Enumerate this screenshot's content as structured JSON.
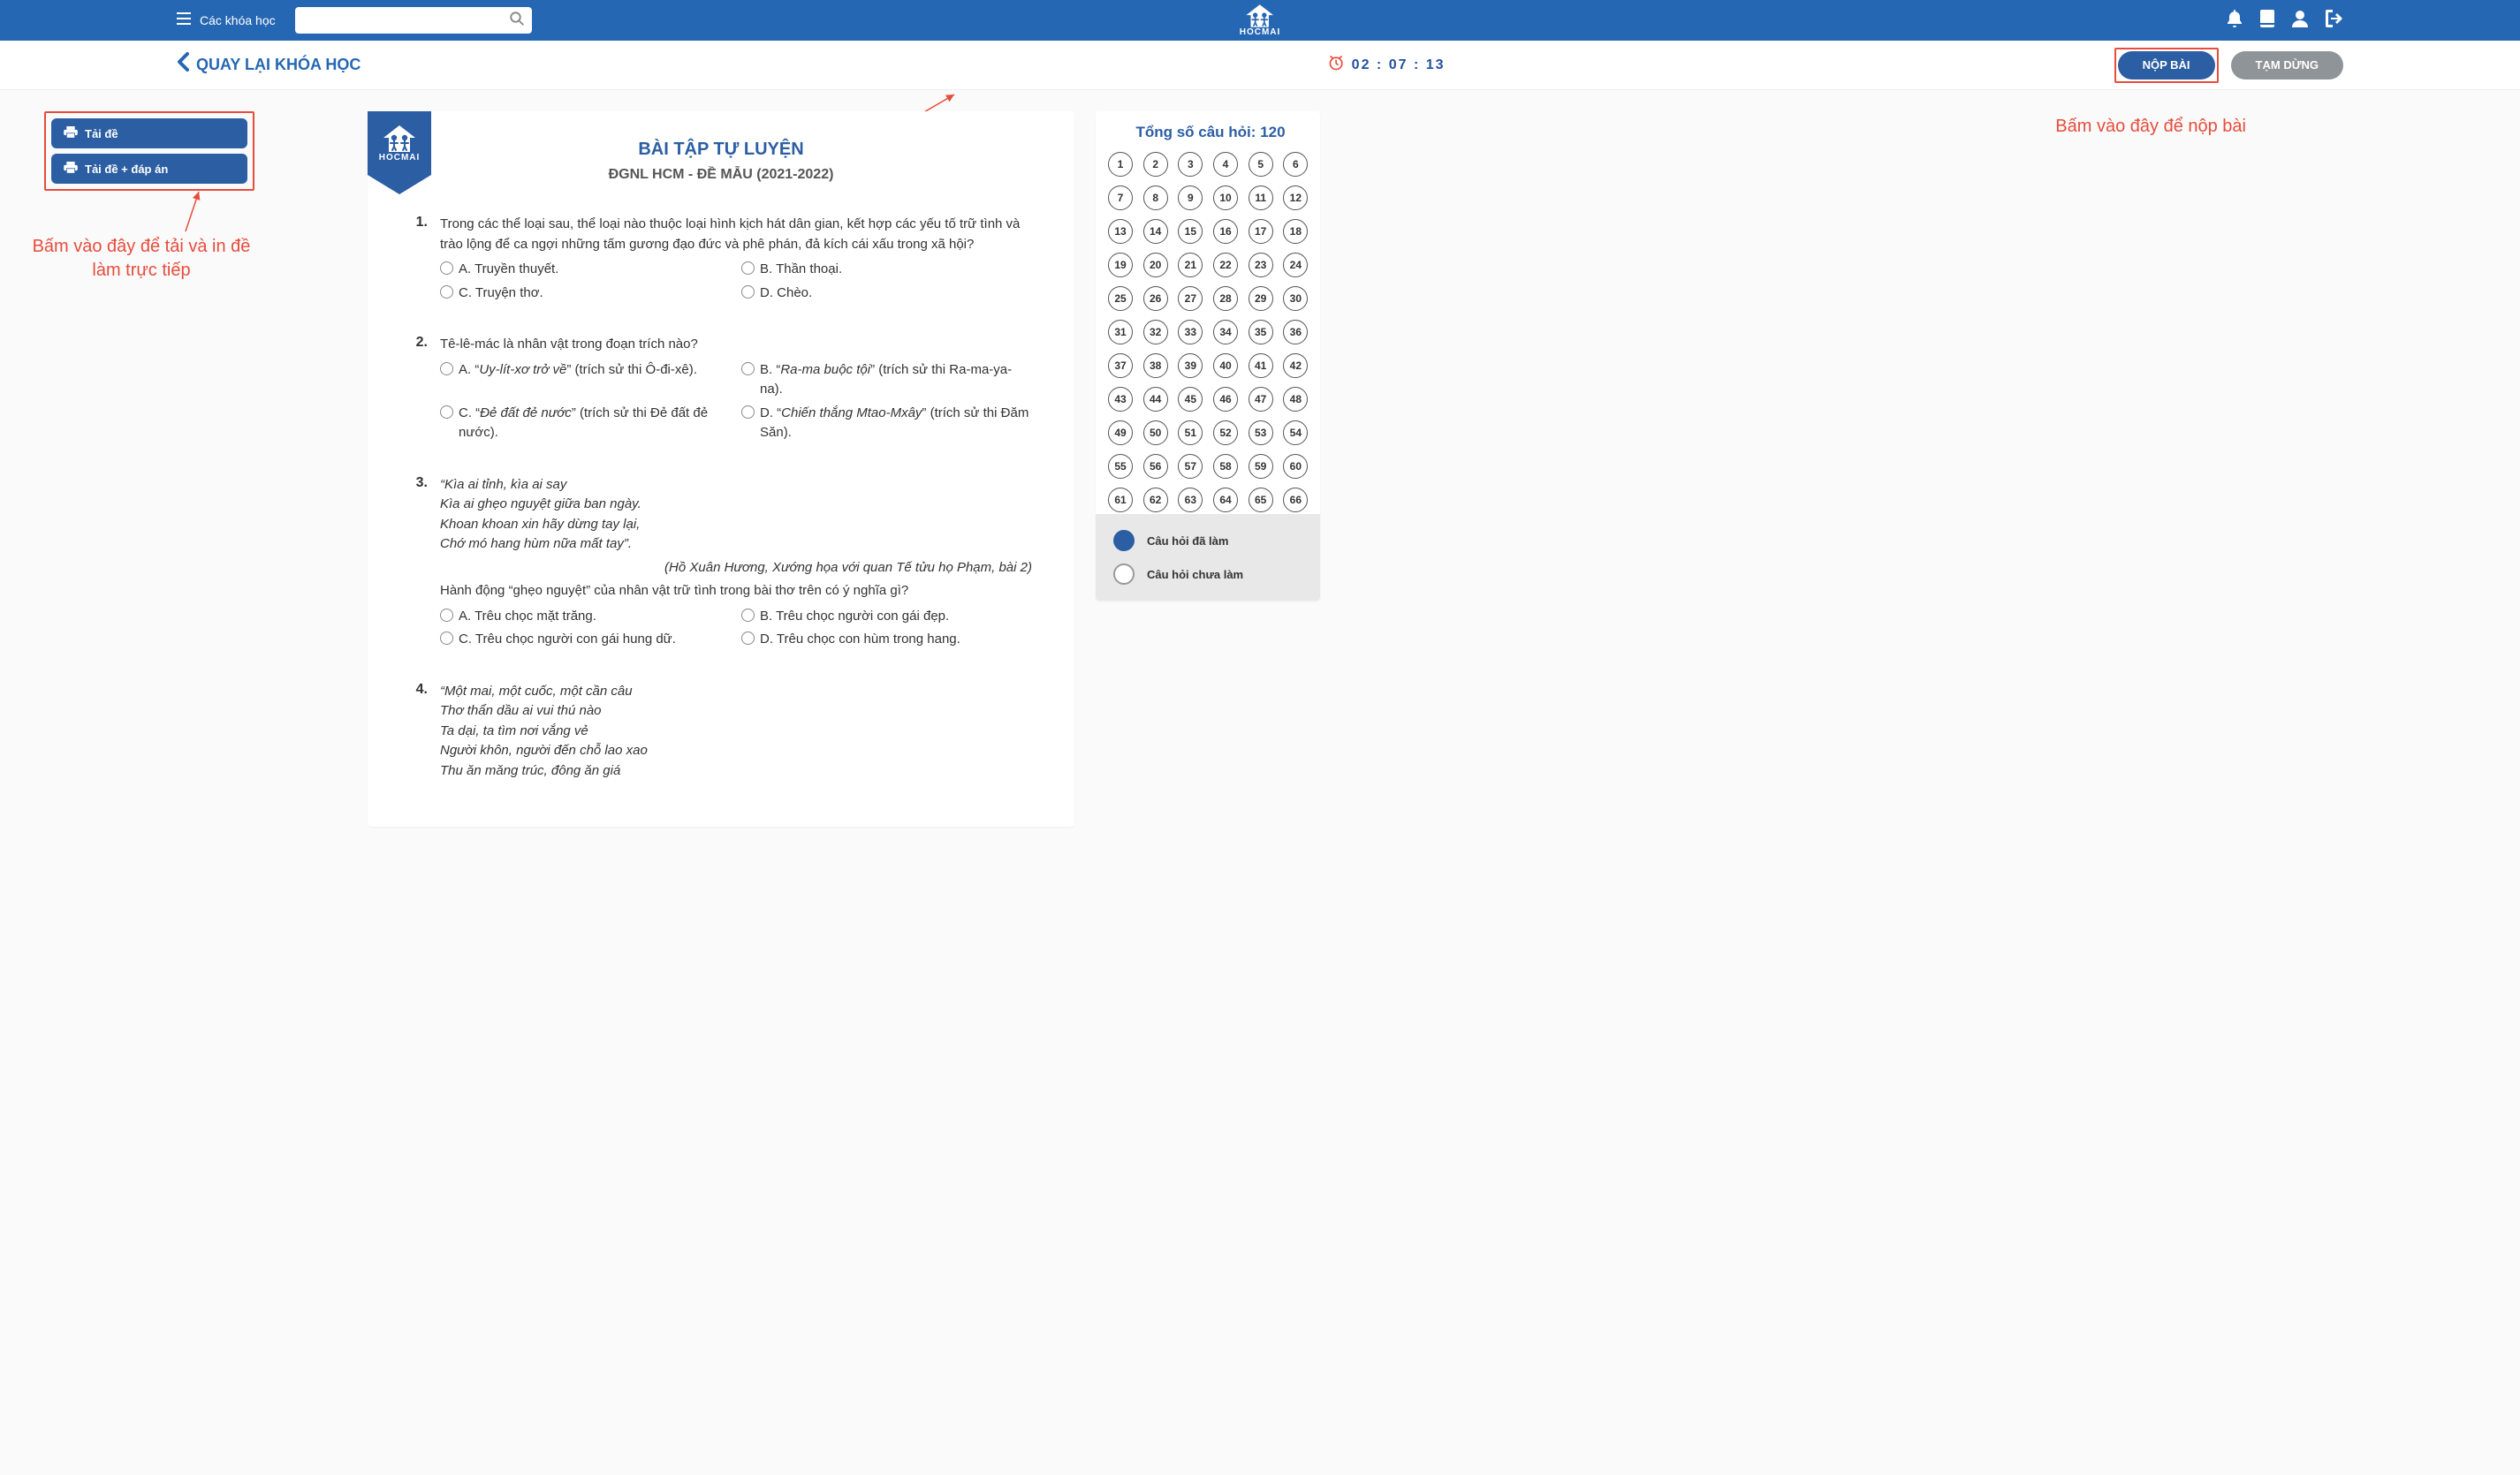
{
  "navbar": {
    "courses_label": "Các khóa học",
    "search_placeholder": ""
  },
  "subheader": {
    "back_label": "QUAY LẠI KHÓA HỌC",
    "timer": "02 : 07 : 13",
    "submit_label": "NỘP BÀI",
    "pause_label": "TẠM DỪNG"
  },
  "downloads": {
    "btn1": "Tải đề",
    "btn2": "Tải đề + đáp án"
  },
  "annotations": {
    "submit_hint": "Bấm vào đây để nộp bài",
    "download_hint": "Bấm vào đây để tải và in đề làm trực tiếp"
  },
  "paper": {
    "brand": "HOCMAI",
    "title": "BÀI TẬP TỰ LUYỆN",
    "subtitle": "ĐGNL HCM - ĐỀ MẪU (2021-2022)",
    "questions": [
      {
        "num": "1.",
        "text": "Trong các thể loại sau, thể loại nào thuộc loại hình kịch hát dân gian, kết hợp các yếu tố trữ tình và trào lộng để ca ngợi những tấm gương đạo đức và phê phán, đả kích cái xấu trong xã hội?",
        "opts": [
          "A. Truyền thuyết.",
          "B. Thần thoại.",
          "C. Truyện thơ.",
          "D. Chèo."
        ]
      },
      {
        "num": "2.",
        "text": "Tê-lê-mác là nhân vật trong đoạn trích nào?",
        "opts": [
          "A. “Uy-lít-xơ trở về” (trích sử thi Ô-đi-xê).",
          "B. “Ra-ma buộc tội” (trích sử thi Ra-ma-ya-na).",
          "C. “Đẻ đất đẻ nước” (trích sử thi Đẻ đất đẻ nước).",
          "D. “Chiến thắng Mtao-Mxây” (trích sử thi Đăm Săn)."
        ]
      },
      {
        "num": "3.",
        "poem": "“Kìa ai tỉnh, kìa ai say\nKìa ai ghẹo nguyệt giữa ban ngày.\nKhoan khoan xin hãy dừng tay lại,\nChớ mó hang hùm nữa mất tay”.",
        "poem_ref": "(Hồ Xuân Hương, Xướng họa với quan Tế tửu họ Phạm, bài 2)",
        "text_after": "Hành động “ghẹo nguyệt” của nhân vật trữ tình trong bài thơ trên có ý nghĩa gì?",
        "opts": [
          "A. Trêu chọc mặt trăng.",
          "B. Trêu chọc người con gái đẹp.",
          "C. Trêu chọc người con gái hung dữ.",
          "D. Trêu chọc con hùm trong hang."
        ]
      },
      {
        "num": "4.",
        "poem": "“Một mai, một cuốc, một cần câu\nThơ thẩn dầu ai vui thú nào\nTa dại, ta tìm nơi vắng vẻ\nNgười khôn, người đến chỗ lao xao\nThu ăn măng trúc, đông ăn giá"
      }
    ]
  },
  "qpanel": {
    "title_prefix": "Tổng số câu hỏi: ",
    "total": 120,
    "legend_done": "Câu hỏi đã làm",
    "legend_todo": "Câu hỏi chưa làm"
  },
  "icons": {
    "menu": "menu-icon",
    "search": "search-icon",
    "bell": "bell-icon",
    "book": "book-icon",
    "user": "user-icon",
    "logout": "logout-icon",
    "chevron_left": "chevron-left-icon",
    "clock": "alarm-icon",
    "printer": "printer-icon"
  }
}
